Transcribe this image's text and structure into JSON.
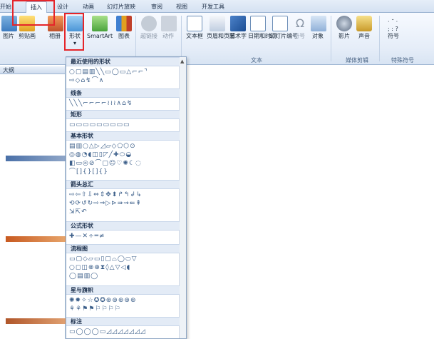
{
  "tabs": [
    {
      "label": "开始"
    },
    {
      "label": "插入"
    },
    {
      "label": "设计"
    },
    {
      "label": "动画"
    },
    {
      "label": "幻灯片放映"
    },
    {
      "label": "审阅"
    },
    {
      "label": "视图"
    },
    {
      "label": "开发工具"
    }
  ],
  "ribbon": {
    "buttons": [
      {
        "label": "图片"
      },
      {
        "label": "剪贴画"
      },
      {
        "label": "相册"
      },
      {
        "label": "形状"
      },
      {
        "label": "SmartArt"
      },
      {
        "label": "图表"
      },
      {
        "label": "超链接"
      },
      {
        "label": "动作"
      },
      {
        "label": "文本框"
      },
      {
        "label": "页眉和页脚"
      },
      {
        "label": "艺术字"
      },
      {
        "label": "日期和时间"
      },
      {
        "label": "幻灯片编号"
      },
      {
        "label": "符号"
      },
      {
        "label": "对象"
      },
      {
        "label": "影片"
      },
      {
        "label": "声音"
      },
      {
        "label": "符号"
      }
    ],
    "groups": {
      "text": "文本",
      "media": "媒体剪辑",
      "special": "特殊符号"
    }
  },
  "left_panel": {
    "outline_tab": "大纲"
  },
  "shapes_menu": {
    "sections": [
      {
        "title": "最近使用的形状",
        "rows": [
          "○▢▤▥╲╲▭◯▭△⌐⌐⌝",
          "⇨◇⌂↯⌒∧"
        ]
      },
      {
        "title": "线条",
        "rows": [
          "╲╲╲⌐⌐⌐⌐≀≀≀∧⌂↯"
        ]
      },
      {
        "title": "矩形",
        "rows": [
          "▭▭▭▭▭▭▭▭▭"
        ]
      },
      {
        "title": "基本形状",
        "rows": [
          "▤▥○△▷◿▱◇⬠⬡⊙",
          "◎◍◔◖◫▯◸╱✚⬭◒",
          "◧▭◎⊘⌒▢☺♡✺☾◌",
          "⌒[]{}[]{}"
        ]
      },
      {
        "title": "箭头总汇",
        "rows": [
          "⇨⇦⇧⇩⇔⇕✥⬍↱↰↲↳",
          "⟲⟳↺↻⇨⇒▷⊳⇛⇝⇚⇞",
          "⇲⇱↶"
        ]
      },
      {
        "title": "公式形状",
        "rows": [
          "✚—✕÷═≠"
        ]
      },
      {
        "title": "流程图",
        "rows": [
          "▭▢◇▱▭▯▢⌓◯⬭▽",
          "○◻◫⊗⊕⧗◊△▽◁◖",
          "◯▤▥◯"
        ]
      },
      {
        "title": "星与旗帜",
        "rows": [
          "✺✹✧☆✪✪⊛⊛⊛⊛⊛",
          "⚘⚘⚑⚑⚐⚐⚐⚐"
        ]
      },
      {
        "title": "标注",
        "rows": [
          "▭◯◯◯▭◿◿◿◿◿◿◿"
        ]
      }
    ]
  }
}
